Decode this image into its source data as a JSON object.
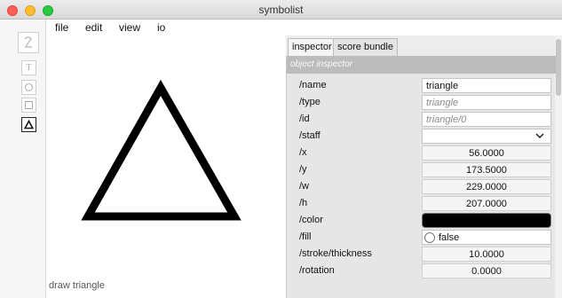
{
  "window": {
    "title": "symbolist"
  },
  "menu": {
    "file": "file",
    "edit": "edit",
    "view": "view",
    "io": "io"
  },
  "palette": {
    "tools": [
      {
        "name": "stroke-tool",
        "icon": "stroke-icon"
      },
      {
        "name": "text-tool",
        "icon": "text-icon",
        "glyph": "T"
      },
      {
        "name": "circle-tool",
        "icon": "circle-icon"
      },
      {
        "name": "rectangle-tool",
        "icon": "rectangle-icon"
      },
      {
        "name": "triangle-tool",
        "icon": "triangle-icon",
        "selected": true
      }
    ]
  },
  "canvas": {
    "shape": {
      "type": "triangle",
      "stroke": "#000000",
      "fill": "none"
    },
    "status": "draw triangle"
  },
  "inspector": {
    "tabs": [
      "inspector",
      "score bundle"
    ],
    "active_tab": "inspector",
    "header": "object inspector",
    "rows": {
      "name": {
        "label": "/name",
        "value": "triangle"
      },
      "type": {
        "label": "/type",
        "value": "triangle"
      },
      "id": {
        "label": "/id",
        "value": "triangle/0"
      },
      "staff": {
        "label": "/staff",
        "value": ""
      },
      "x": {
        "label": "/x",
        "value": "56.0000"
      },
      "y": {
        "label": "/y",
        "value": "173.5000"
      },
      "w": {
        "label": "/w",
        "value": "229.0000"
      },
      "h": {
        "label": "/h",
        "value": "207.0000"
      },
      "color": {
        "label": "/color",
        "value": "#000000"
      },
      "fill": {
        "label": "/fill",
        "value": "false"
      },
      "stroke": {
        "label": "/stroke/thickness",
        "value": "10.0000"
      },
      "rotation": {
        "label": "/rotation",
        "value": "0.0000"
      }
    }
  }
}
